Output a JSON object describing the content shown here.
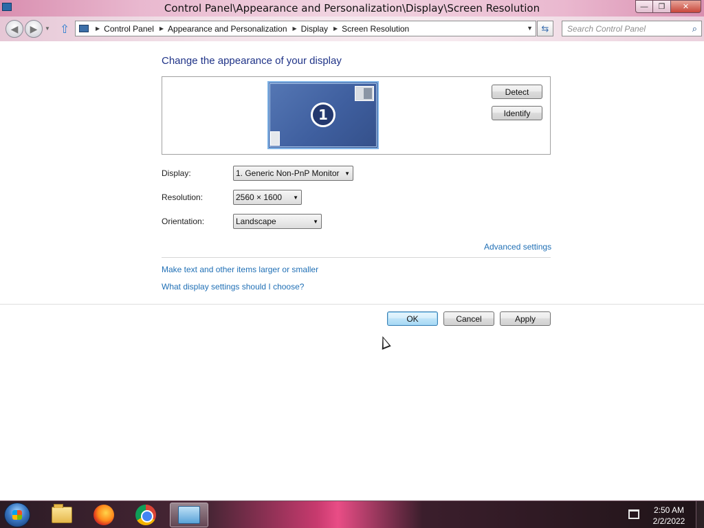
{
  "window": {
    "title": "Control Panel\\Appearance and Personalization\\Display\\Screen Resolution",
    "minimize_glyph": "—",
    "maximize_glyph": "❐",
    "close_glyph": "✕"
  },
  "nav": {
    "back_glyph": "◀",
    "forward_glyph": "▶",
    "breadcrumbs": [
      "Control Panel",
      "Appearance and Personalization",
      "Display",
      "Screen Resolution"
    ],
    "search_placeholder": "Search Control Panel"
  },
  "main": {
    "page_title": "Change the appearance of your display",
    "monitor_number": "1",
    "detect_label": "Detect",
    "identify_label": "Identify",
    "display": {
      "label": "Display:",
      "value": "1. Generic Non-PnP Monitor"
    },
    "resolution": {
      "label": "Resolution:",
      "value": "2560 × 1600"
    },
    "orientation": {
      "label": "Orientation:",
      "value": "Landscape"
    },
    "advanced_link": "Advanced settings",
    "links": [
      "Make text and other items larger or smaller",
      "What display settings should I choose?"
    ],
    "ok_label": "OK",
    "cancel_label": "Cancel",
    "apply_label": "Apply"
  },
  "taskbar": {
    "time": "2:50 AM",
    "date": "2/2/2022"
  }
}
